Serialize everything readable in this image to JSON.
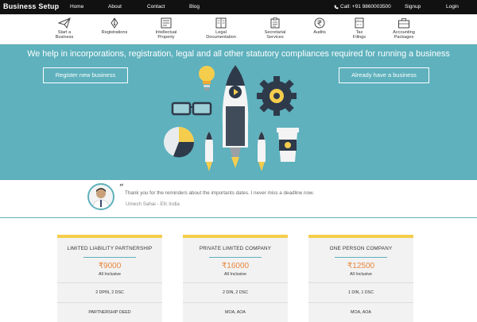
{
  "header": {
    "brand": "Business Setup",
    "nav": [
      "Home",
      "About",
      "Contact",
      "Blog"
    ],
    "phone": "Call: +91 9860003500",
    "signup": "Signup",
    "login": "Login"
  },
  "services": [
    {
      "line1": "Start a",
      "line2": "Business",
      "icon": "paper-plane-icon"
    },
    {
      "line1": "Registrations",
      "line2": "",
      "icon": "pen-nib-icon"
    },
    {
      "line1": "Intellectual",
      "line2": "Property",
      "icon": "id-card-icon"
    },
    {
      "line1": "Legal",
      "line2": "Documentation",
      "icon": "book-icon"
    },
    {
      "line1": "Secretarial",
      "line2": "Services",
      "icon": "clipboard-icon"
    },
    {
      "line1": "Audits",
      "line2": "",
      "icon": "rupee-coin-icon"
    },
    {
      "line1": "Tax",
      "line2": "Filings",
      "icon": "calculator-icon"
    },
    {
      "line1": "Accounting",
      "line2": "Packages",
      "icon": "briefcase-icon"
    }
  ],
  "hero": {
    "headline": "We help in incorporations, registration, legal and all other statutory compliances required for running a business",
    "register_label": "Register new business",
    "existing_label": "Already have a business",
    "bg_color": "#5eb1bd"
  },
  "testimonial": {
    "quote_mark": "“",
    "quote": "Thank you for the reminders about the importants dates. I never miss a deadline now.",
    "author": "Umesh Sahai - Efc India"
  },
  "plans": [
    {
      "title": "LIMITED LIABILITY PARTNERSHIP",
      "price": "₹9000",
      "note": "All Inclusive",
      "features": [
        "2 DPIN, 2 DSC",
        "PARTNERSHIP DEED"
      ]
    },
    {
      "title": "PRIVATE LIMITED COMPANY",
      "price": "₹16000",
      "note": "All Inclusive",
      "features": [
        "2 DIN, 2 DSC",
        "MOA, AOA"
      ]
    },
    {
      "title": "ONE PERSON COMPANY",
      "price": "₹12500",
      "note": "All Inclusive",
      "features": [
        "1 DIN, 1 DSC",
        "MOA, AOA"
      ]
    }
  ],
  "colors": {
    "accent": "#5eb1bd",
    "price": "#e8853b",
    "card_top": "#f5cd4d",
    "topbar": "#111111"
  }
}
